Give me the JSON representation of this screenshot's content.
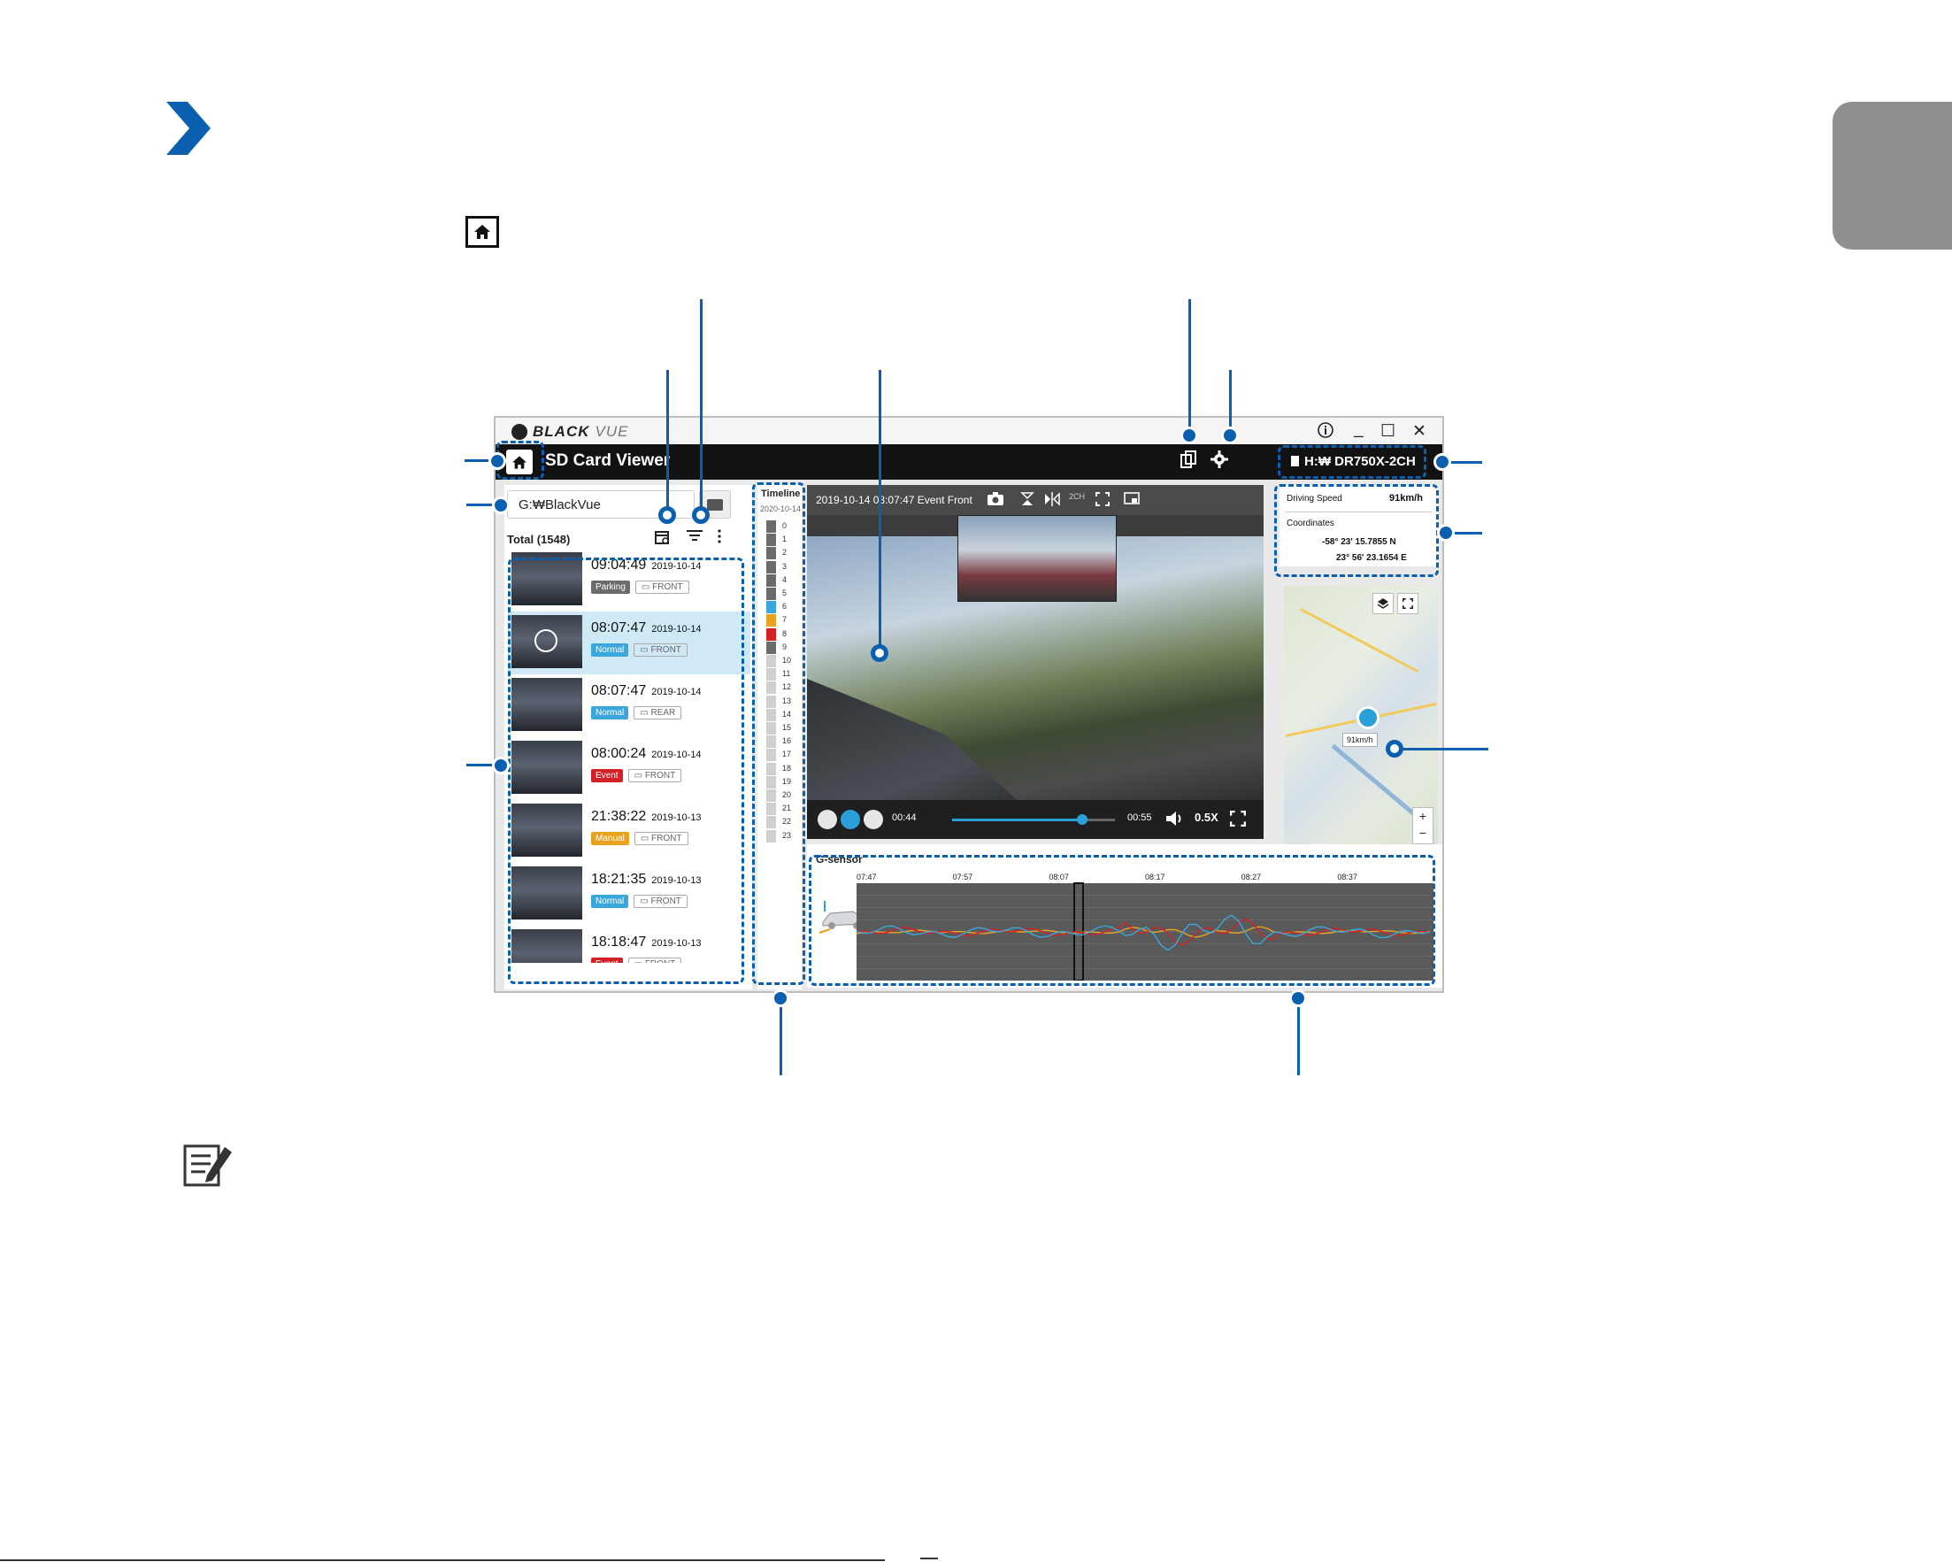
{
  "app": {
    "brand_black": "BLACK",
    "brand_vue": "VUE",
    "title": "SD Card Viewer",
    "drive": "H:₩ DR750X-2CH",
    "info_icon": "info-icon",
    "minimize_glyph": "_",
    "maximize_glyph": "☐",
    "close_glyph": "✕"
  },
  "left_panel": {
    "path": "G:₩BlackVue",
    "total": "Total (1548)",
    "recordings": [
      {
        "time": "09:04:49",
        "date": "2019-10-14",
        "type": "Parking",
        "type_color": "#6b6b6b",
        "camera": "FRONT"
      },
      {
        "time": "08:07:47",
        "date": "2019-10-14",
        "type": "Normal",
        "type_color": "#3aa7dc",
        "camera": "FRONT",
        "selected": true
      },
      {
        "time": "08:07:47",
        "date": "2019-10-14",
        "type": "Normal",
        "type_color": "#3aa7dc",
        "camera": "REAR"
      },
      {
        "time": "08:00:24",
        "date": "2019-10-14",
        "type": "Event",
        "type_color": "#d42027",
        "camera": "FRONT"
      },
      {
        "time": "21:38:22",
        "date": "2019-10-13",
        "type": "Manual",
        "type_color": "#e8a21f",
        "camera": "FRONT"
      },
      {
        "time": "18:21:35",
        "date": "2019-10-13",
        "type": "Normal",
        "type_color": "#3aa7dc",
        "camera": "FRONT"
      },
      {
        "time": "18:18:47",
        "date": "2019-10-13",
        "type": "Event",
        "type_color": "#d42027",
        "camera": "FRONT"
      }
    ]
  },
  "timeline": {
    "title": "Timeline",
    "date": "2020-10-14",
    "hours": [
      "0",
      "1",
      "2",
      "3",
      "4",
      "5",
      "6",
      "7",
      "8",
      "9",
      "10",
      "11",
      "12",
      "13",
      "14",
      "15",
      "16",
      "17",
      "18",
      "19",
      "20",
      "21",
      "22",
      "23"
    ],
    "hour_colors": [
      "#6b6b6b",
      "#6b6b6b",
      "#6b6b6b",
      "#6b6b6b",
      "#6b6b6b",
      "#6b6b6b",
      "#3aa7dc",
      "#e8a21f",
      "#d42027",
      "#6b6b6b",
      "#cfcfcf",
      "#cfcfcf",
      "#cfcfcf",
      "#cfcfcf",
      "#cfcfcf",
      "#cfcfcf",
      "#cfcfcf",
      "#cfcfcf",
      "#cfcfcf",
      "#cfcfcf",
      "#cfcfcf",
      "#cfcfcf",
      "#cfcfcf",
      "#cfcfcf"
    ]
  },
  "video": {
    "title": "2019-10-14 08:07:47 Event Front",
    "mode": "2CH",
    "current_time": "00:44",
    "total_time": "00:55",
    "progress": 0.8,
    "speed": "0.5X"
  },
  "info": {
    "speed_label": "Driving Speed",
    "speed_value": "91km/h",
    "coords_label": "Coordinates",
    "lat": "-58° 23'  15.7855 N",
    "lon": "23° 56'  23.1654 E"
  },
  "map": {
    "speed_tag": "91km/h",
    "zoom_in": "+",
    "zoom_out": "−"
  },
  "gsensor": {
    "title": "G-sensor",
    "ticks": [
      "07:47",
      "07:57",
      "08:07",
      "08:17",
      "08:27",
      "08:37"
    ]
  },
  "colors": {
    "accent": "#0a5fae",
    "normal": "#3aa7dc",
    "event": "#d42027",
    "manual": "#e8a21f",
    "parking": "#6b6b6b"
  }
}
